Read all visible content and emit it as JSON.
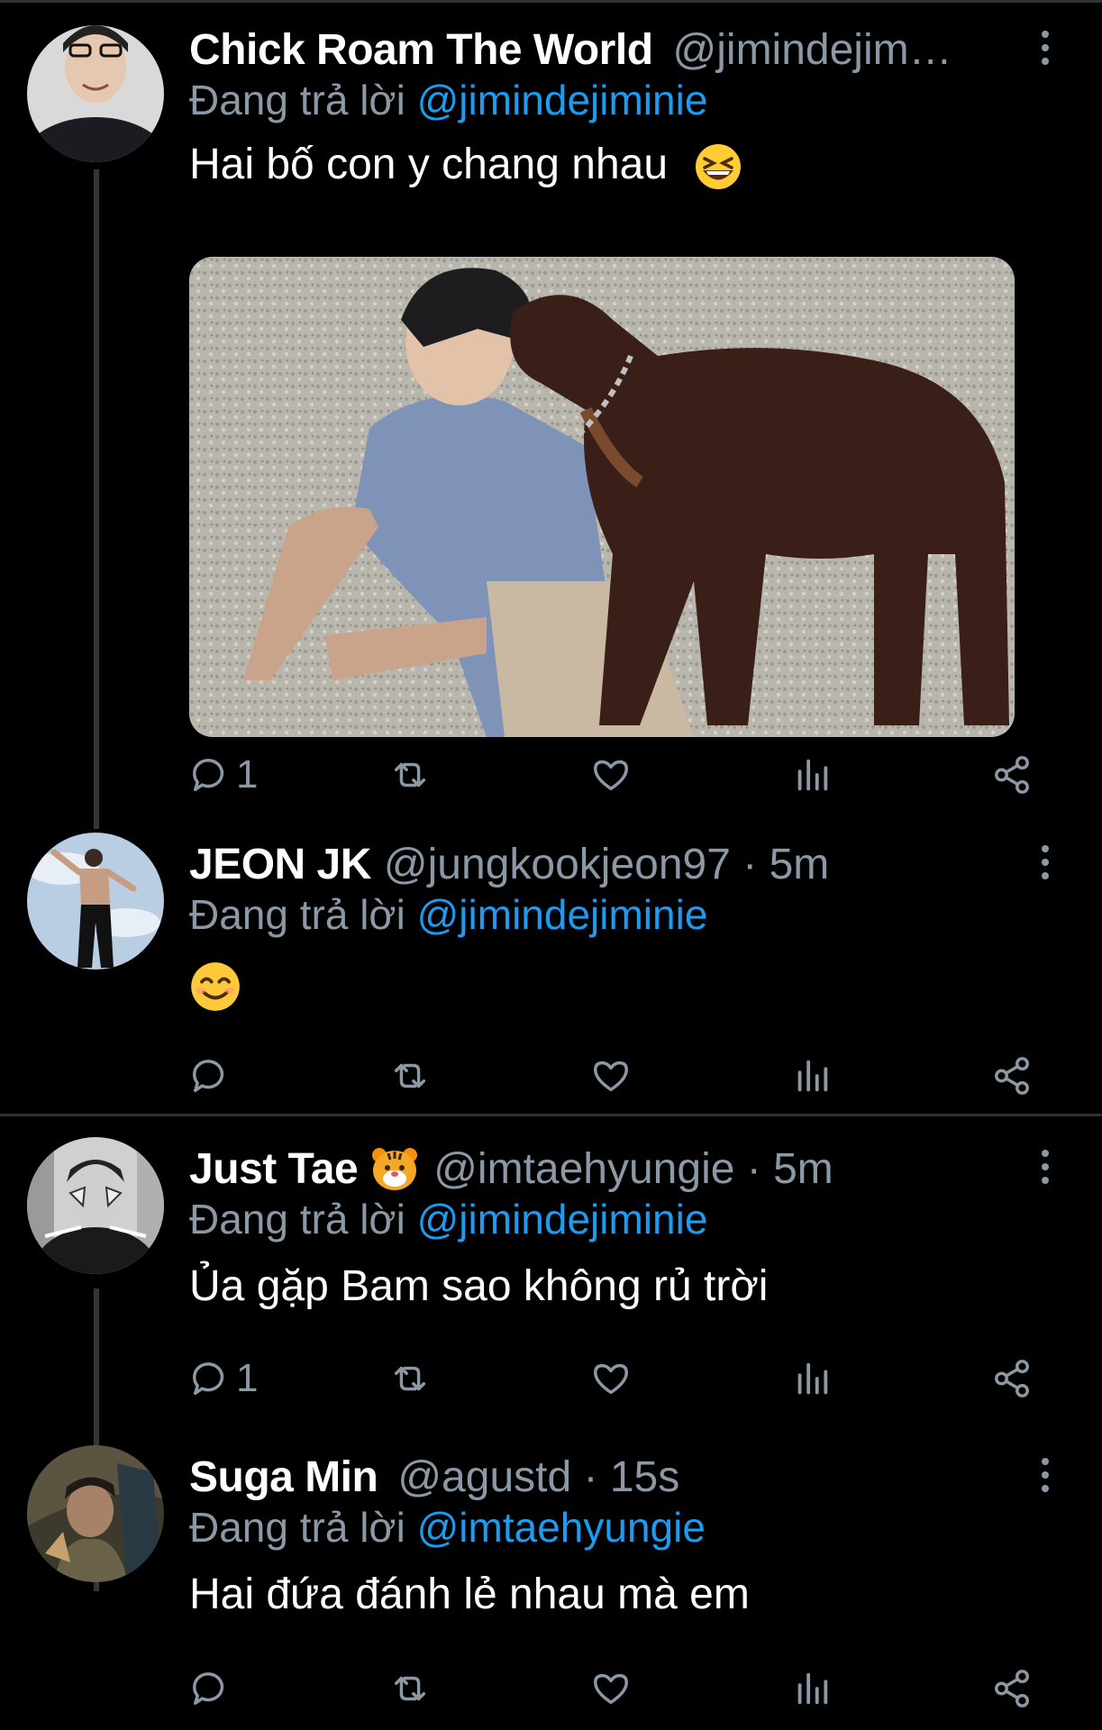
{
  "colors": {
    "accent": "#1d9bf0",
    "secondary_text": "#8b98a5",
    "background": "#000000"
  },
  "tweets": [
    {
      "name": "Chick Roam The World",
      "handle": "@jimindejim…",
      "replying_prefix": "Đang trả lời ",
      "replying_to": "@jimindejiminie",
      "text": "Hai bố con y chang nhau",
      "text_emoji": "grinning-squinting-face-emoji",
      "media": "photo-person-with-doberman",
      "reply_count": "1"
    },
    {
      "name": "JEON JK",
      "handle": "@jungkookjeon97 · 5m",
      "replying_prefix": "Đang trả lời ",
      "replying_to": "@jimindejiminie",
      "text": "",
      "text_emoji": "smiling-face-emoji",
      "reply_count": ""
    },
    {
      "name": "Just Tae",
      "name_emoji": "tiger-face-emoji",
      "handle": "@imtaehyungie · 5m",
      "replying_prefix": "Đang trả lời ",
      "replying_to": "@jimindejiminie",
      "text": "Ủa gặp Bam sao không rủ trời",
      "reply_count": "1"
    },
    {
      "name": "Suga Min",
      "handle": "@agustd · 15s",
      "replying_prefix": "Đang trả lời ",
      "replying_to": "@imtaehyungie",
      "text": "Hai đứa đánh lẻ nhau mà em",
      "reply_count": ""
    }
  ]
}
